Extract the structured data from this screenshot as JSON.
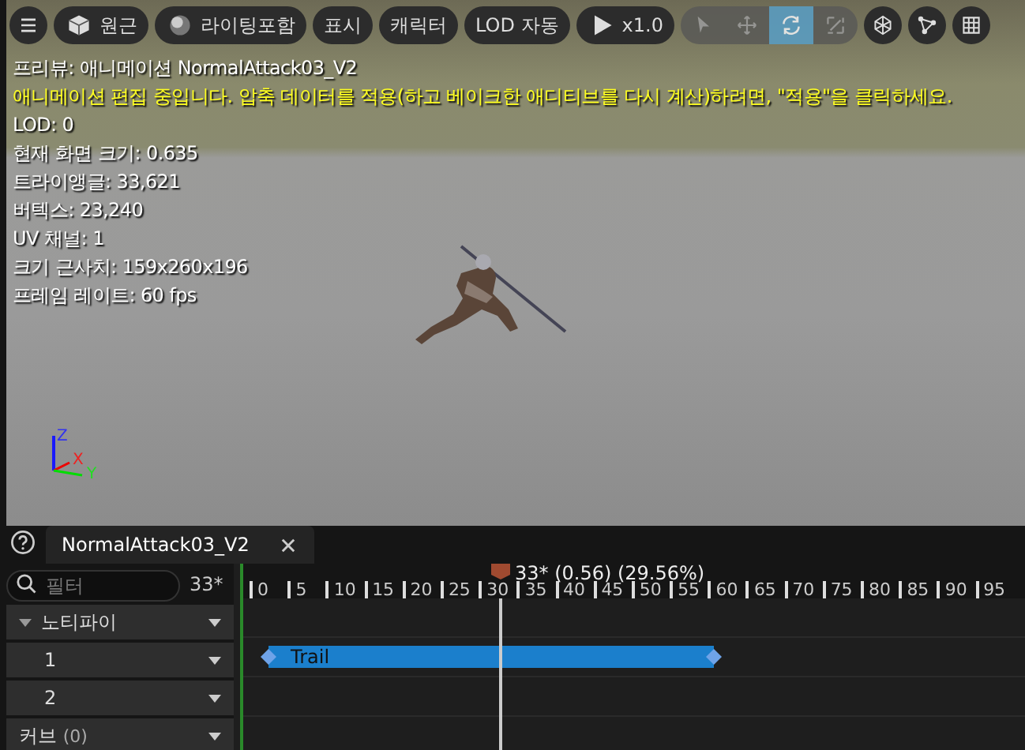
{
  "toolbar": {
    "items": [
      {
        "kind": "menu"
      },
      {
        "kind": "cube",
        "label": "원근"
      },
      {
        "kind": "sphere",
        "label": "라이팅포함"
      },
      {
        "kind": "text",
        "label": "표시"
      },
      {
        "kind": "text",
        "label": "캐릭터"
      },
      {
        "kind": "text",
        "label": "LOD 자동"
      },
      {
        "kind": "play",
        "label": "x1.0"
      }
    ],
    "transform_tools": [
      {
        "kind": "select",
        "selected": false
      },
      {
        "kind": "move",
        "selected": false
      },
      {
        "kind": "rotate",
        "selected": true
      },
      {
        "kind": "scale",
        "selected": false
      }
    ],
    "view_buttons": [
      {
        "kind": "bone"
      },
      {
        "kind": "nodes"
      },
      {
        "kind": "grid"
      }
    ]
  },
  "overlay": [
    {
      "kind": "info",
      "text": "프리뷰: 애니메이션 NormalAttack03_V2"
    },
    {
      "kind": "warning",
      "text": "애니메이션 편집 중입니다. 압축 데이터를 적용(하고 베이크한 애디티브를 다시 계산)하려면, \"적용\"을 클릭하세요."
    },
    {
      "kind": "info",
      "text": "LOD: 0"
    },
    {
      "kind": "info",
      "text": "현재 화면 크기: 0.635"
    },
    {
      "kind": "info",
      "text": "트라이앵글: 33,621"
    },
    {
      "kind": "info",
      "text": "버텍스: 23,240"
    },
    {
      "kind": "info",
      "text": "UV 채널: 1"
    },
    {
      "kind": "info",
      "text": "크기 근사치: 159x260x196"
    },
    {
      "kind": "info",
      "text": "프레임 레이트: 60 fps"
    }
  ],
  "axes": {
    "z": "Z",
    "x": "X",
    "y": "Y"
  },
  "tab": {
    "label": "NormalAttack03_V2",
    "selected": true
  },
  "filter": {
    "placeholder": "필터",
    "frame": "33*"
  },
  "tracks": [
    {
      "kind": "group",
      "label": "노티파이",
      "expanded": true
    },
    {
      "kind": "track",
      "label": "1",
      "notifies": [
        {
          "label": "Trail"
        }
      ]
    },
    {
      "kind": "track",
      "label": "2"
    },
    {
      "kind": "group",
      "label": "커브",
      "count": "(0)"
    }
  ],
  "timeline": {
    "ticks": [
      "0",
      "5",
      "10",
      "15",
      "20",
      "25",
      "30",
      "35",
      "40",
      "45",
      "50",
      "55",
      "60",
      "65",
      "70",
      "75",
      "80",
      "85",
      "90",
      "95"
    ],
    "playhead": {
      "reading": "33* (0.56) (29.56%)"
    }
  }
}
